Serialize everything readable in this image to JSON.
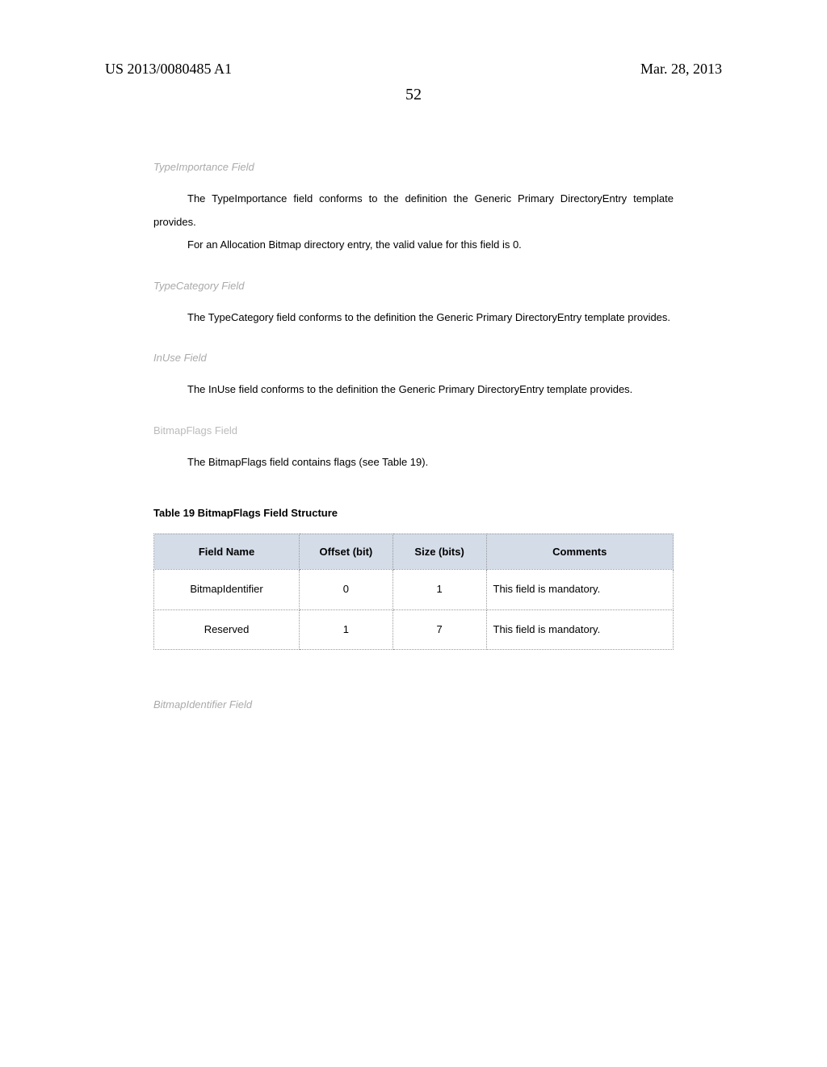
{
  "header": {
    "pub_number": "US 2013/0080485 A1",
    "pub_date": "Mar. 28, 2013",
    "page_number": "52"
  },
  "sections": {
    "typeimportance": {
      "heading": "TypeImportance Field",
      "para1": "The TypeImportance field conforms to the definition the Generic Primary DirectoryEntry template provides.",
      "para2": "For an Allocation Bitmap directory entry, the valid value for this field is 0."
    },
    "typecategory": {
      "heading": "TypeCategory Field",
      "para1": "The TypeCategory field conforms to the definition the Generic Primary DirectoryEntry template provides."
    },
    "inuse": {
      "heading": "InUse Field",
      "para1": "The InUse field conforms to the definition the Generic Primary DirectoryEntry template provides."
    },
    "bitmapflags": {
      "heading": "BitmapFlags Field",
      "para1": "The BitmapFlags field contains flags (see Table 19)."
    },
    "bitmapidentifier": {
      "heading": "BitmapIdentifier Field"
    }
  },
  "table": {
    "title": "Table 19 BitmapFlags Field Structure",
    "headers": {
      "field_name": "Field Name",
      "offset": "Offset (bit)",
      "size": "Size (bits)",
      "comments": "Comments"
    },
    "rows": [
      {
        "field_name": "BitmapIdentifier",
        "offset": "0",
        "size": "1",
        "comments": "This field is mandatory."
      },
      {
        "field_name": "Reserved",
        "offset": "1",
        "size": "7",
        "comments": "This field is mandatory."
      }
    ]
  }
}
